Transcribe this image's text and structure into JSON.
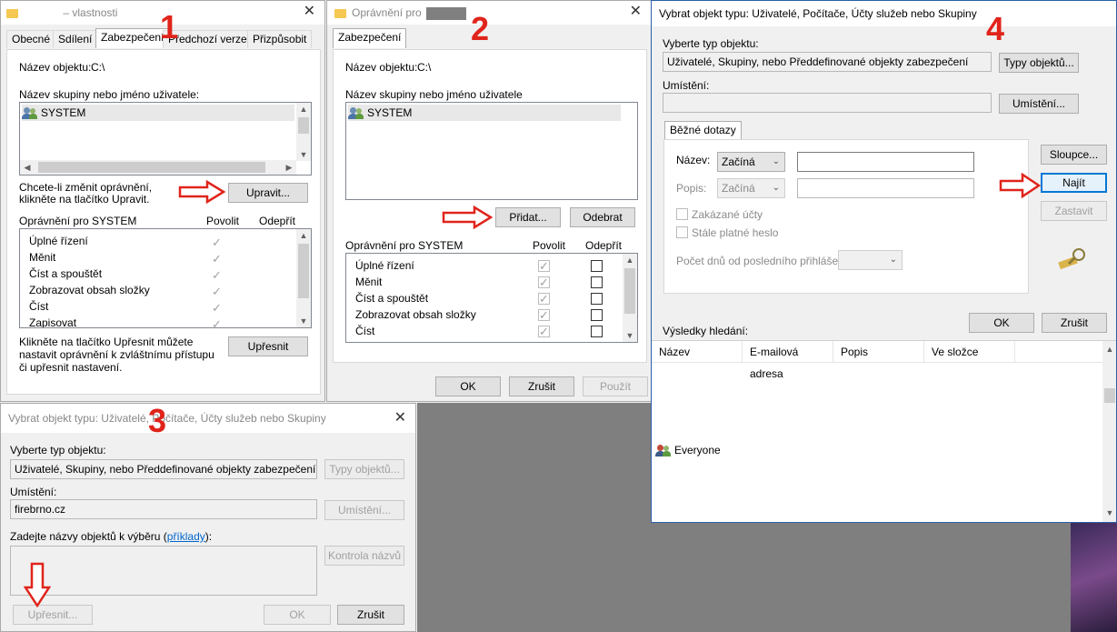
{
  "annotations": {
    "n1": "1",
    "n2": "2",
    "n3": "3",
    "n4": "4"
  },
  "w1": {
    "title": "– vlastnosti",
    "tabs": [
      "Obecné",
      "Sdílení",
      "Zabezpečení",
      "Předchozí verze",
      "Přizpůsobit"
    ],
    "object_label": "Název objektu:",
    "object_value": "C:\\",
    "group_label": "Název skupiny nebo jméno uživatele:",
    "group_item": "SYSTEM",
    "change_text": "Chcete-li změnit oprávnění, klikněte na tlačítko Upravit.",
    "edit_button": "Upravit...",
    "perm_header": "Oprávnění pro SYSTEM",
    "allow_col": "Povolit",
    "deny_col": "Odepřít",
    "perms": [
      "Úplné řízení",
      "Měnit",
      "Číst a spouštět",
      "Zobrazovat obsah složky",
      "Číst",
      "Zapisovat"
    ],
    "advanced_text": "Klikněte na tlačítko Upřesnit můžete nastavit oprávnění k zvláštnímu přístupu či upřesnit nastavení.",
    "advanced_button": "Upřesnit"
  },
  "w2": {
    "title": "Oprávnění pro",
    "tab": "Zabezpečení",
    "object_label": "Název objektu:",
    "object_value": "C:\\",
    "group_label": "Název skupiny nebo jméno uživatele",
    "group_item": "SYSTEM",
    "add_button": "Přidat...",
    "remove_button": "Odebrat",
    "perm_header": "Oprávnění pro SYSTEM",
    "allow_col": "Povolit",
    "deny_col": "Odepřít",
    "perms": [
      "Úplné řízení",
      "Měnit",
      "Číst a spouštět",
      "Zobrazovat obsah složky",
      "Číst"
    ],
    "ok_button": "OK",
    "cancel_button": "Zrušit",
    "apply_button": "Použít"
  },
  "w3": {
    "title": "Vybrat objekt typu: Uživatelé, Počítače, Účty služeb nebo Skupiny",
    "type_label": "Vyberte typ objektu:",
    "type_value": "Uživatelé, Skupiny, nebo Předdefinované objekty zabezpečení",
    "types_button": "Typy objektů...",
    "location_label": "Umístění:",
    "location_value": "firebrno.cz",
    "location_button": "Umístění...",
    "names_label": "Zadejte názvy objektů k výběru (",
    "names_link": "příklady",
    "names_label_end": "):",
    "check_button": "Kontrola názvů",
    "advanced_button": "Upřesnit...",
    "ok_button": "OK",
    "cancel_button": "Zrušit"
  },
  "w4": {
    "title": "Vybrat objekt typu: Uživatelé, Počítače, Účty služeb nebo Skupiny",
    "type_label": "Vyberte typ objektu:",
    "type_value": "Uživatelé, Skupiny, nebo Předdefinované objekty zabezpečení",
    "types_button": "Typy objektů...",
    "location_label": "Umístění:",
    "location_button": "Umístění...",
    "tab": "Běžné dotazy",
    "name_label": "Název:",
    "name_op": "Začíná",
    "desc_label": "Popis:",
    "desc_op": "Začíná",
    "disabled_accounts": "Zakázané účty",
    "non_expiring": "Stále platné heslo",
    "days_label": "Počet dnů od posledního přihlášení:",
    "columns_button": "Sloupce...",
    "find_button": "Najít",
    "stop_button": "Zastavit",
    "ok_button": "OK",
    "cancel_button": "Zrušit",
    "results_label": "Výsledky hledání:",
    "result_cols": [
      "Název",
      "E-mailová adresa",
      "Popis",
      "Ve složce"
    ],
    "result_item": "Everyone"
  }
}
